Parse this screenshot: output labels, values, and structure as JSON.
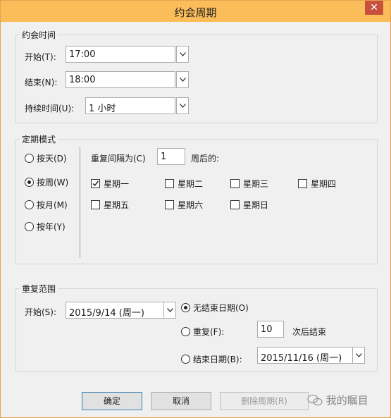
{
  "window": {
    "title": "约会周期",
    "close_glyph": "✕"
  },
  "appointment_time": {
    "legend": "约会时间",
    "start_label": "开始(T):",
    "start_value": "17:00",
    "end_label": "结束(N):",
    "end_value": "18:00",
    "duration_label": "持续时间(U):",
    "duration_value": "1 小时"
  },
  "recurrence_pattern": {
    "legend": "定期模式",
    "options": [
      {
        "label": "按天(D)",
        "selected": false
      },
      {
        "label": "按周(W)",
        "selected": true
      },
      {
        "label": "按月(M)",
        "selected": false
      },
      {
        "label": "按年(Y)",
        "selected": false
      }
    ],
    "interval_label": "重复间隔为(C)",
    "interval_value": "1",
    "interval_suffix": "周后的:",
    "weekdays": [
      {
        "label": "星期一",
        "checked": true
      },
      {
        "label": "星期二",
        "checked": false
      },
      {
        "label": "星期三",
        "checked": false
      },
      {
        "label": "星期四",
        "checked": false
      },
      {
        "label": "星期五",
        "checked": false
      },
      {
        "label": "星期六",
        "checked": false
      },
      {
        "label": "星期日",
        "checked": false
      }
    ]
  },
  "range": {
    "legend": "重复范围",
    "start_label": "开始(S):",
    "start_value": "2015/9/14 (周一)",
    "no_end_label": "无结束日期(O)",
    "no_end_selected": true,
    "repeat_label": "重复(F):",
    "repeat_value": "10",
    "repeat_suffix": "次后结束",
    "repeat_selected": false,
    "end_by_label": "结束日期(B):",
    "end_by_value": "2015/11/16 (周一)",
    "end_by_selected": false
  },
  "buttons": {
    "ok": "确定",
    "cancel": "取消",
    "remove": "删除周期(R)"
  },
  "watermark": "我的瞩目",
  "colors": {
    "titlebar": "#fbbd5a",
    "close": "#c7503f",
    "dialog_bg": "#f0f0f0"
  }
}
